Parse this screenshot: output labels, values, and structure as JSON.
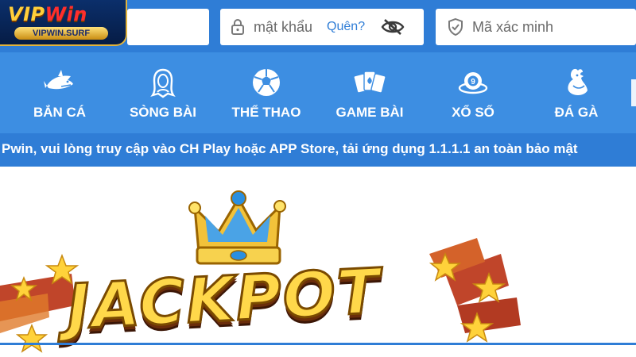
{
  "brand": {
    "logo_main_prefix": "VIP",
    "logo_main_suffix": "Win",
    "logo_sub": "VIPWIN.SURF"
  },
  "login": {
    "password_placeholder": "mật khẩu",
    "forgot_label": "Quên?",
    "captcha_placeholder": "Mã xác minh"
  },
  "nav": {
    "items": [
      {
        "label": "BẮN CÁ",
        "icon": "shark-icon"
      },
      {
        "label": "SÒNG BÀI",
        "icon": "dealer-icon"
      },
      {
        "label": "THỂ THAO",
        "icon": "soccer-ball-icon"
      },
      {
        "label": "GAME BÀI",
        "icon": "playing-cards-icon"
      },
      {
        "label": "XỔ SỐ",
        "icon": "lottery-ball-icon"
      },
      {
        "label": "ĐÁ GÀ",
        "icon": "rooster-icon"
      }
    ]
  },
  "ticker": {
    "text": "Pwin, vui lòng truy cập vào CH Play hoặc APP Store, tải ứng dụng 1.1.1.1 an toàn bảo mật"
  },
  "banner": {
    "title": "JACKPOT"
  },
  "colors": {
    "header_bg": "#2f7dd6",
    "nav_bg": "#3d8ee2",
    "gold": "#ffd84a",
    "brand_red": "#ff2e2e"
  }
}
